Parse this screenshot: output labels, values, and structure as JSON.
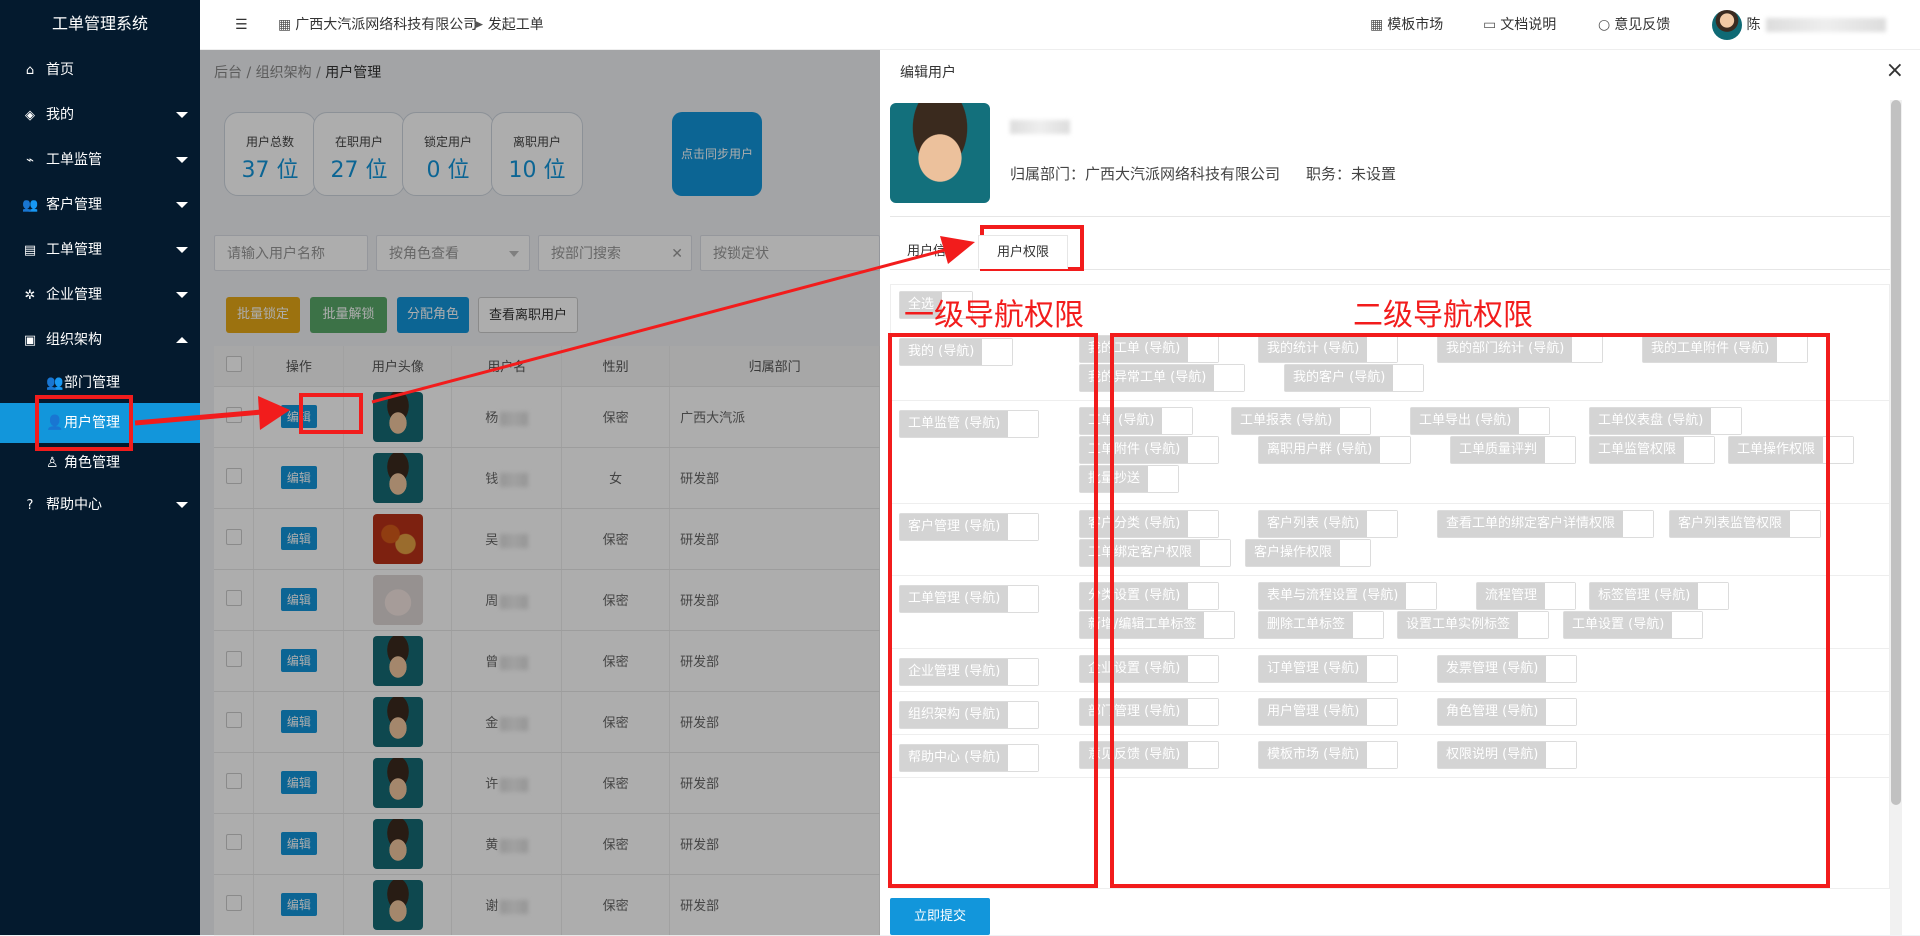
{
  "app_title": "工单管理系统",
  "sidebar": {
    "items": [
      {
        "label": "首页",
        "icon": "home-icon",
        "glyph": "⌂",
        "caret": ""
      },
      {
        "label": "我的",
        "icon": "layers-icon",
        "glyph": "◈",
        "caret": "down"
      },
      {
        "label": "工单监管",
        "icon": "pulse-icon",
        "glyph": "⌁",
        "caret": "down"
      },
      {
        "label": "客户管理",
        "icon": "users-icon",
        "glyph": "👥",
        "caret": "down"
      },
      {
        "label": "工单管理",
        "icon": "document-icon",
        "glyph": "▤",
        "caret": "down"
      },
      {
        "label": "企业管理",
        "icon": "gear-icon",
        "glyph": "✲",
        "caret": "down"
      },
      {
        "label": "组织架构",
        "icon": "org-icon",
        "glyph": "▣",
        "caret": "up"
      }
    ],
    "sub": [
      {
        "label": "部门管理",
        "glyph": "👥"
      },
      {
        "label": "用户管理",
        "glyph": "👤"
      },
      {
        "label": "角色管理",
        "glyph": "♙"
      }
    ],
    "help": {
      "label": "帮助中心",
      "glyph": "?"
    }
  },
  "topbar": {
    "company": "广西大汽派网络科技有限公司",
    "new_ticket": "发起工单",
    "template_market": "模板市场",
    "docs": "文档说明",
    "feedback": "意见反馈",
    "user": "陈"
  },
  "breadcrumb": {
    "a": "后台",
    "b": "组织架构",
    "c": "用户管理",
    "sep": "/"
  },
  "stats": [
    {
      "label": "用户总数",
      "value": "37 位"
    },
    {
      "label": "在职用户",
      "value": "27 位"
    },
    {
      "label": "锁定用户",
      "value": "0 位"
    },
    {
      "label": "离职用户",
      "value": "10 位"
    }
  ],
  "sync_label": "点击同步用户",
  "filters": {
    "name": "请输入用户名称",
    "role": "按角色查看",
    "dept": "按部门搜索",
    "lock": "按锁定状"
  },
  "actions": {
    "lock": "批量锁定",
    "unlock": "批量解锁",
    "assign": "分配角色",
    "left": "查看离职用户"
  },
  "colors": {
    "lock": "#e6a817",
    "unlock": "#59a869",
    "assign": "#1296db",
    "accent": "#1296db",
    "annotation": "#f21c1c"
  },
  "table": {
    "headers": [
      "操作",
      "用户头像",
      "用户名",
      "性别",
      "归属部门"
    ],
    "edit_label": "编辑",
    "rows": [
      {
        "avatar": "boy",
        "name": "杨",
        "gender": "保密",
        "dept": "广西大汽派"
      },
      {
        "avatar": "boy",
        "name": "钱",
        "gender": "女",
        "dept": "研发部"
      },
      {
        "avatar": "food",
        "name": "吴",
        "gender": "保密",
        "dept": "研发部"
      },
      {
        "avatar": "cat",
        "name": "周",
        "gender": "保密",
        "dept": "研发部"
      },
      {
        "avatar": "boy",
        "name": "曾",
        "gender": "保密",
        "dept": "研发部"
      },
      {
        "avatar": "boy",
        "name": "金",
        "gender": "保密",
        "dept": "研发部"
      },
      {
        "avatar": "boy",
        "name": "许",
        "gender": "保密",
        "dept": "研发部"
      },
      {
        "avatar": "boy",
        "name": "黄",
        "gender": "保密",
        "dept": "研发部"
      },
      {
        "avatar": "boy",
        "name": "谢",
        "gender": "保密",
        "dept": "研发部"
      }
    ]
  },
  "drawer": {
    "title": "编辑用户",
    "dept_line": "归属部门：广西大汽派网络科技有限公司",
    "position_line": "职务：未设置",
    "tabs": [
      "用户信息",
      "用户权限"
    ],
    "submit": "立即提交",
    "select_all": "全选",
    "level1_label": "一级导航权限",
    "level2_label": "二级导航权限",
    "groups": [
      {
        "primary": "我的 (导航)",
        "secondary": [
          "我的工单 (导航)",
          "我的统计 (导航)",
          "我的部门统计 (导航)",
          "我的工单附件 (导航)",
          "我的异常工单 (导航)",
          "我的客户 (导航)"
        ]
      },
      {
        "primary": "工单监管 (导航)",
        "secondary": [
          "工单 (导航)",
          "工单报表 (导航)",
          "工单导出 (导航)",
          "工单仪表盘 (导航)",
          "工单附件 (导航)",
          "离职用户群 (导航)",
          "工单质量评判",
          "工单监管权限",
          "工单操作权限",
          "批量抄送"
        ]
      },
      {
        "primary": "客户管理 (导航)",
        "secondary": [
          "客户分类 (导航)",
          "客户列表 (导航)",
          "查看工单的绑定客户详情权限",
          "客户列表监管权限",
          "工单绑定客户权限",
          "客户操作权限"
        ]
      },
      {
        "primary": "工单管理 (导航)",
        "secondary": [
          "分类设置 (导航)",
          "表单与流程设置 (导航)",
          "流程管理",
          "标签管理 (导航)",
          "新增/编辑工单标签",
          "删除工单标签",
          "设置工单实例标签",
          "工单设置 (导航)"
        ]
      },
      {
        "primary": "企业管理 (导航)",
        "secondary": [
          "企业设置 (导航)",
          "订单管理 (导航)",
          "发票管理 (导航)"
        ]
      },
      {
        "primary": "组织架构 (导航)",
        "secondary": [
          "部门管理 (导航)",
          "用户管理 (导航)",
          "角色管理 (导航)"
        ]
      },
      {
        "primary": "帮助中心 (导航)",
        "secondary": [
          "意见反馈 (导航)",
          "模板市场 (导航)",
          "权限说明 (导航)"
        ]
      }
    ]
  }
}
